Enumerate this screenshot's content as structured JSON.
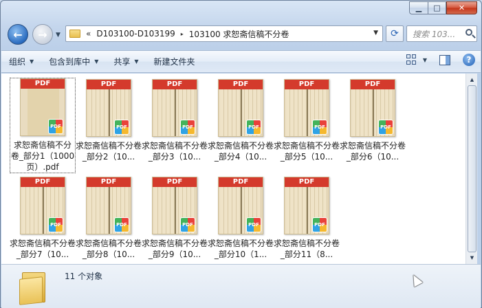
{
  "window": {
    "minimize_glyph": "▁",
    "maximize_glyph": "□",
    "close_glyph": "✕"
  },
  "nav": {
    "back_glyph": "←",
    "forward_glyph": "→",
    "dropdown_glyph": "▼"
  },
  "address": {
    "overflow_chevron": "«",
    "crumbs": [
      "D103100-D103199",
      "103100 求恕斋信稿不分卷"
    ],
    "separator": "▸",
    "dropdown_glyph": "▼",
    "refresh_glyph": "⟳"
  },
  "search": {
    "placeholder": "搜索 103..."
  },
  "toolbar": {
    "organize": "组织",
    "include_in_library": "包含到库中",
    "share": "共享",
    "new_folder": "新建文件夹",
    "arrow": "▼",
    "help_glyph": "?"
  },
  "thumb_label": "PDF",
  "badge_label": "PDF",
  "files": [
    {
      "name": "求恕斋信稿不分卷_部分1（1000页）.pdf",
      "selected": true
    },
    {
      "name": "求恕斋信稿不分卷_部分2（10..."
    },
    {
      "name": "求恕斋信稿不分卷_部分3（10..."
    },
    {
      "name": "求恕斋信稿不分卷_部分4（10..."
    },
    {
      "name": "求恕斋信稿不分卷_部分5（10..."
    },
    {
      "name": "求恕斋信稿不分卷_部分6（10..."
    },
    {
      "name": "求恕斋信稿不分卷_部分7（10..."
    },
    {
      "name": "求恕斋信稿不分卷_部分8（10..."
    },
    {
      "name": "求恕斋信稿不分卷_部分9（10..."
    },
    {
      "name": "求恕斋信稿不分卷_部分10（1..."
    },
    {
      "name": "求恕斋信稿不分卷_部分11（8..."
    }
  ],
  "scrollbar": {
    "up_glyph": "▲",
    "down_glyph": "▼"
  },
  "status": {
    "count_text": "11 个对象"
  }
}
